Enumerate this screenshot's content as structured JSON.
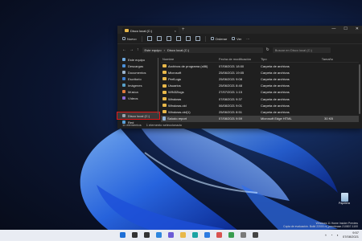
{
  "window": {
    "tab_title": "Disco local (C:)",
    "tab_close": "×",
    "tab_add": "+",
    "controls": [
      "—",
      "☐",
      "✕"
    ]
  },
  "cmdbar": {
    "new_label": "Nuevo",
    "sort_label": "Ordenar",
    "view_label": "Ver",
    "more": "···"
  },
  "address": {
    "path": [
      "Este equipo",
      "Disco local (C:)"
    ],
    "search_placeholder": "Buscar en Disco local (C:)"
  },
  "sidebar": {
    "items": [
      {
        "label": "Este equipo",
        "icon": "pc-icon",
        "color": "#6fa8dc"
      },
      {
        "label": "Descargas",
        "icon": "download-icon",
        "color": "#4a90d9"
      },
      {
        "label": "Documentos",
        "icon": "documents-icon",
        "color": "#9ab3cc"
      },
      {
        "label": "Escritorio",
        "icon": "desktop-icon",
        "color": "#3d7ccc"
      },
      {
        "label": "Imágenes",
        "icon": "pictures-icon",
        "color": "#58a0c8"
      },
      {
        "label": "Música",
        "icon": "music-icon",
        "color": "#e07b3c"
      },
      {
        "label": "Vídeos",
        "icon": "videos-icon",
        "color": "#8a6ad1"
      },
      {
        "label": "Disco local (C:)",
        "icon": "drive-icon",
        "color": "#9aa4ad",
        "selected": true
      },
      {
        "label": "Red",
        "icon": "network-icon",
        "color": "#5aa0d8"
      }
    ]
  },
  "table": {
    "headers": [
      "Nombre",
      "Fecha de modificación",
      "Tipo",
      "Tamaño"
    ],
    "rows": [
      {
        "name": "Archivos de programa (x86)",
        "date": "07/08/2021 18:00",
        "type": "Carpeta de archivos",
        "size": ""
      },
      {
        "name": "Microsoft",
        "date": "25/06/2021 19:05",
        "type": "Carpeta de archivos",
        "size": ""
      },
      {
        "name": "PerfLogs",
        "date": "25/06/2021 9:08",
        "type": "Carpeta de archivos",
        "size": ""
      },
      {
        "name": "Usuarios",
        "date": "25/06/2021 8:48",
        "type": "Carpeta de archivos",
        "size": ""
      },
      {
        "name": "WIN32logs",
        "date": "27/07/2021 1:15",
        "type": "Carpeta de archivos",
        "size": ""
      },
      {
        "name": "Windows",
        "date": "07/08/2021 9:37",
        "type": "Carpeta de archivos",
        "size": ""
      },
      {
        "name": "Windows.old",
        "date": "06/08/2021 9:01",
        "type": "Carpeta de archivos",
        "size": ""
      },
      {
        "name": "Windows.old(1)",
        "date": "25/06/2021 8:51",
        "type": "Carpeta de archivos",
        "size": ""
      },
      {
        "name": "Saludo.report",
        "date": "07/08/2021 9:59",
        "type": "Microsoft Edge HTML",
        "size": "30 KB",
        "selected": true,
        "file": true
      }
    ]
  },
  "status": {
    "count": "11 elementos",
    "selection": "1 elemento seleccionado"
  },
  "desktop": {
    "recycle_label": "Papelera",
    "watermark_line1": "Windows 11 Home Insider Preview",
    "watermark_line2": "Copia de evaluación. Build 22000.rs_prerelease.210807-1100"
  },
  "taskbar": {
    "icons": [
      {
        "name": "start-icon",
        "color": "#1f6fd6"
      },
      {
        "name": "search-icon",
        "color": "#333333"
      },
      {
        "name": "task-view-icon",
        "color": "#333333"
      },
      {
        "name": "widgets-icon",
        "color": "#2e86de"
      },
      {
        "name": "chat-icon",
        "color": "#6b5bd6"
      },
      {
        "name": "file-explorer-icon",
        "color": "#e8b84a"
      },
      {
        "name": "edge-icon",
        "color": "#1aa3a3"
      },
      {
        "name": "store-icon",
        "color": "#2d7be0"
      },
      {
        "name": "app-1-icon",
        "color": "#d9534f"
      },
      {
        "name": "app-2-icon",
        "color": "#3a9d4f"
      },
      {
        "name": "app-3-icon",
        "color": "#7a7a7a"
      },
      {
        "name": "app-4-icon",
        "color": "#444444"
      }
    ],
    "time": "9:57",
    "date": "07/08/2021"
  }
}
